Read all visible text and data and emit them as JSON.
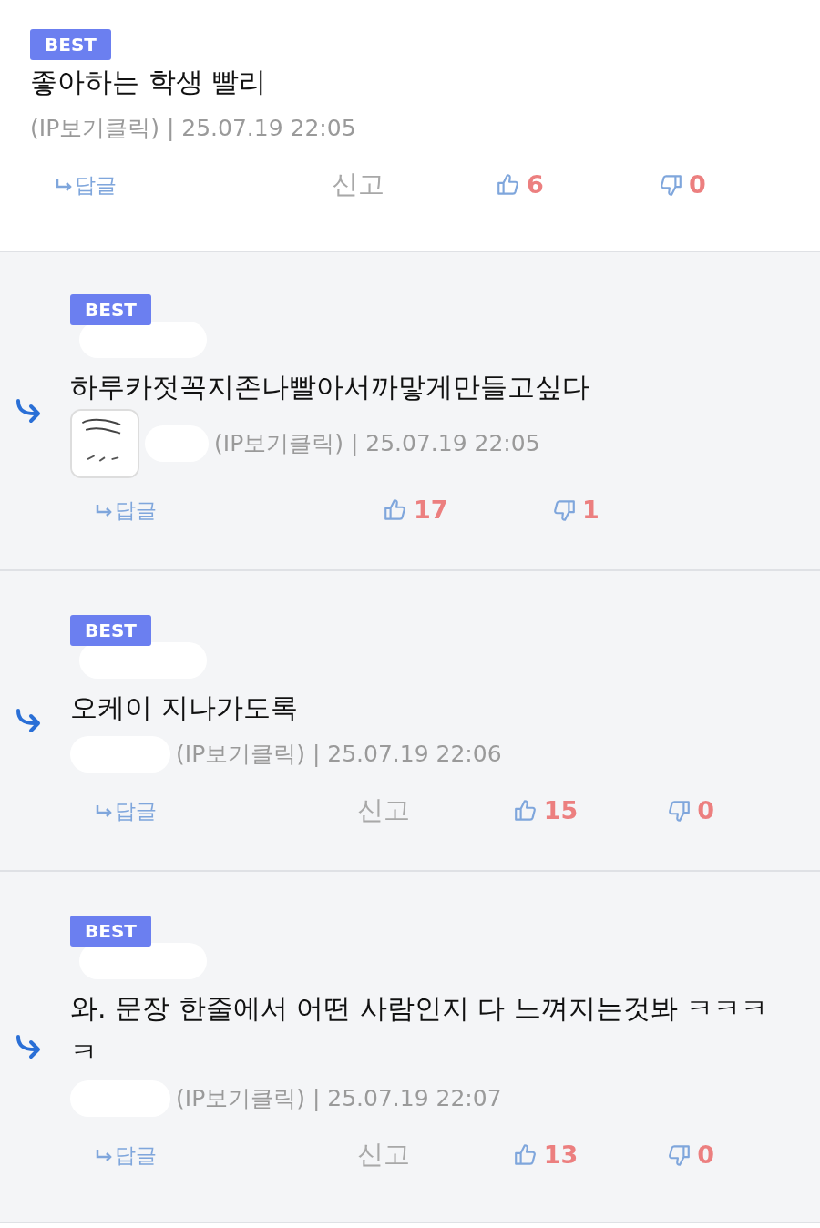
{
  "comments": [
    {
      "best": true,
      "badge": "BEST",
      "is_reply": false,
      "avatar": false,
      "text": "좋아하는 학생 빨리",
      "meta": "(IP보기클릭) | 25.07.19 22:05",
      "reply_label": "답글",
      "report": "신고",
      "likes": "6",
      "dislikes": "0"
    },
    {
      "best": true,
      "badge": "BEST",
      "is_reply": true,
      "avatar": true,
      "text": "하루카젓꼭지존나빨아서까맣게만들고싶다",
      "meta": "(IP보기클릭) | 25.07.19 22:05",
      "reply_label": "답글",
      "likes": "17",
      "dislikes": "1"
    },
    {
      "best": true,
      "badge": "BEST",
      "is_reply": true,
      "avatar": false,
      "text": "오케이 지나가도록",
      "meta": "(IP보기클릭) | 25.07.19 22:06",
      "reply_label": "답글",
      "report": "신고",
      "likes": "15",
      "dislikes": "0"
    },
    {
      "best": true,
      "badge": "BEST",
      "is_reply": true,
      "avatar": false,
      "text": "와. 문장 한줄에서 어떤 사람인지 다 느껴지는것봐 ㅋㅋㅋㅋ",
      "meta": "(IP보기클릭) | 25.07.19 22:07",
      "reply_label": "답글",
      "report": "신고",
      "likes": "13",
      "dislikes": "0"
    }
  ]
}
